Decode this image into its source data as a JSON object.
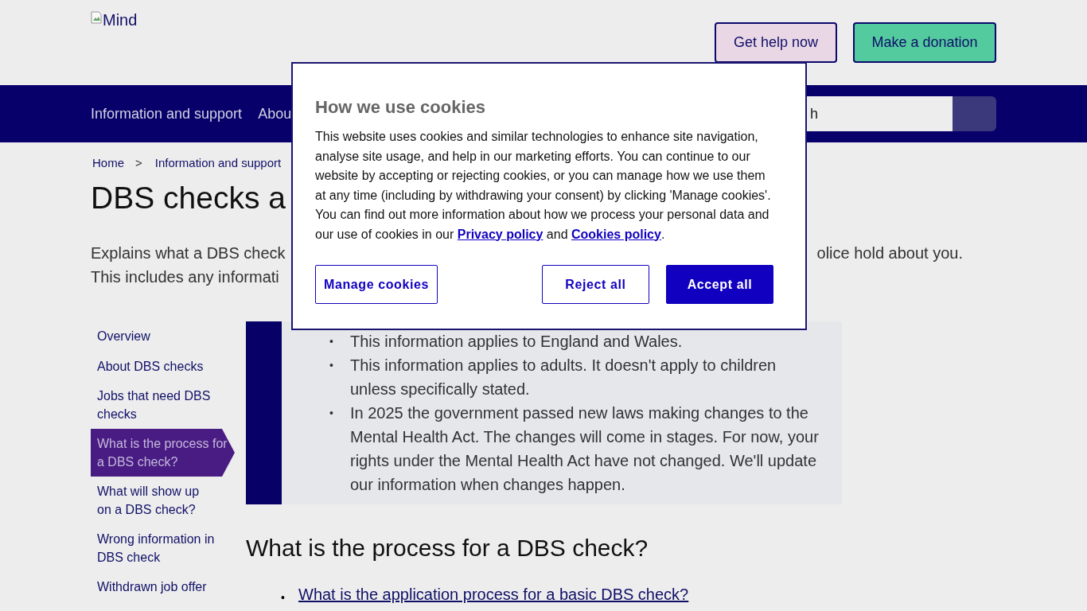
{
  "header": {
    "logo_alt": "Mind",
    "buttons": [
      {
        "label": "Get help now",
        "kind": "help"
      },
      {
        "label": "Make a donation",
        "kind": "donate"
      }
    ]
  },
  "nav": {
    "items": [
      "Information and support",
      "Abou"
    ],
    "search": {
      "placeholder": "h"
    }
  },
  "breadcrumb": [
    "Home",
    ">",
    "Information and support"
  ],
  "title": "DBS checks a",
  "intro": [
    {
      "left": "Explains what a DBS check",
      "right": "olice hold about you."
    },
    {
      "left": "This includes any informati"
    }
  ],
  "sidebar": {
    "items": [
      {
        "label": "Overview",
        "selected": false
      },
      {
        "label": "About DBS checks",
        "selected": false
      },
      {
        "label": "Jobs that need DBS checks",
        "selected": false
      },
      {
        "label": "What is the process for a DBS check?",
        "selected": true
      },
      {
        "label": "What will show up on a DBS check?",
        "selected": false
      },
      {
        "label": "Wrong information in DBS check",
        "selected": false
      },
      {
        "label": "Withdrawn job offer",
        "selected": false
      }
    ]
  },
  "notice": {
    "marker": "•",
    "bullets": [
      "This information applies to England and Wales.",
      "This information applies to adults. It doesn't apply to children unless specifically stated.",
      "In 2025 the government passed new laws making changes to the Mental Health Act. The changes will come in stages. For now, your rights under the Mental Health Act have not changed. We'll update our information when changes happen."
    ]
  },
  "section": {
    "heading": "What is the process for a DBS check?",
    "marker": "•",
    "links": [
      "What is the application process for a basic DBS check?"
    ]
  },
  "cookie_dialog": {
    "title": "How we use cookies",
    "text": "This website uses cookies and similar technologies to enhance site navigation, analyse site usage, and help in our marketing efforts. You can continue to our website by accepting or rejecting cookies, or you can manage how we use them at any time (including by withdrawing your consent) by clicking 'Manage cookies'. You can find out more information about how we process your personal data and our use of cookies in our",
    "links": [
      "Privacy policy",
      "Cookies policy"
    ],
    "joiner": "and",
    "end": ".",
    "buttons": [
      {
        "label": "Manage cookies",
        "kind": "outline"
      },
      {
        "label": "Reject all",
        "kind": "outline"
      },
      {
        "label": "Accept all",
        "kind": "primary"
      }
    ]
  }
}
